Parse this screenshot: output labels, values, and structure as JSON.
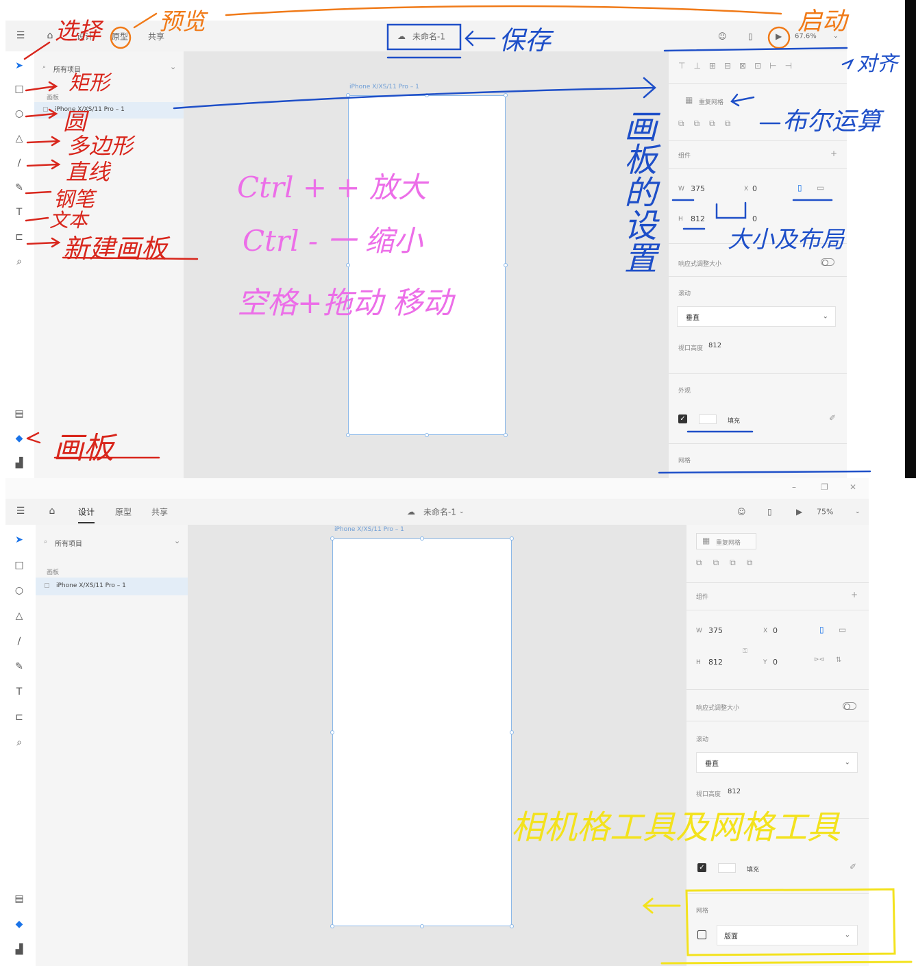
{
  "top": {
    "tabs": [
      "设计",
      "原型",
      "共享"
    ],
    "doc_title": "未命名-1",
    "zoom": "67.6%",
    "search_placeholder": "所有项目",
    "layers_section": "画板",
    "layer_item": "iPhone X/XS/11 Pro – 1",
    "artboard_label": "iPhone X/XS/11 Pro – 1",
    "repeat_grid": "重复网格",
    "components": "组件",
    "w_label": "W",
    "w_value": "375",
    "h_label": "H",
    "h_value": "812",
    "x_label": "X",
    "x_value": "0",
    "y_value": "0",
    "responsive": "响应式调整大小",
    "scroll": "滚动",
    "scroll_value": "垂直",
    "viewport_label": "视口高度",
    "viewport_value": "812",
    "appearance": "外观",
    "fill": "填充",
    "grid": "网格"
  },
  "bottom": {
    "tabs": [
      "设计",
      "原型",
      "共享"
    ],
    "doc_title": "未命名-1",
    "zoom": "75%",
    "search_placeholder": "所有项目",
    "layers_section": "画板",
    "layer_item": "iPhone X/XS/11 Pro – 1",
    "artboard_label": "iPhone X/XS/11 Pro – 1",
    "repeat_grid": "重复网格",
    "components": "组件",
    "w_label": "W",
    "w_value": "375",
    "h_label": "H",
    "h_value": "812",
    "x_label": "X",
    "x_value": "0",
    "y_label": "Y",
    "y_value": "0",
    "responsive": "响应式调整大小",
    "scroll": "滚动",
    "scroll_value": "垂直",
    "viewport_label": "视口高度",
    "viewport_value": "812",
    "fill": "填充",
    "grid": "网格",
    "grid_value": "版面"
  },
  "annotations": {
    "select": "选择",
    "preview": "预览",
    "save": "保存",
    "launch": "启动",
    "align": "对齐",
    "boolean": "布尔运算",
    "rect": "矩形",
    "circle": "圆",
    "polygon": "多边形",
    "line": "直线",
    "pen": "钢笔",
    "text": "文本",
    "new_artboard": "新建画板",
    "artboard": "画板",
    "artboard_settings": "画板的设置",
    "size_layout": "大小及布局",
    "zoom_in": "Ctrl + + 放大",
    "zoom_out": "Ctrl - 一 缩小",
    "move": "空格+拖动 移动",
    "grid_tools": "相机格工具及网格工具"
  },
  "colors": {
    "red_ink": "#d8261c",
    "orange_ink": "#f07a18",
    "blue_ink": "#1e4fc8",
    "pink_ink": "#ec6ee8",
    "yellow_ink": "#f3e21d",
    "artboard_border": "#8bb8e8"
  }
}
